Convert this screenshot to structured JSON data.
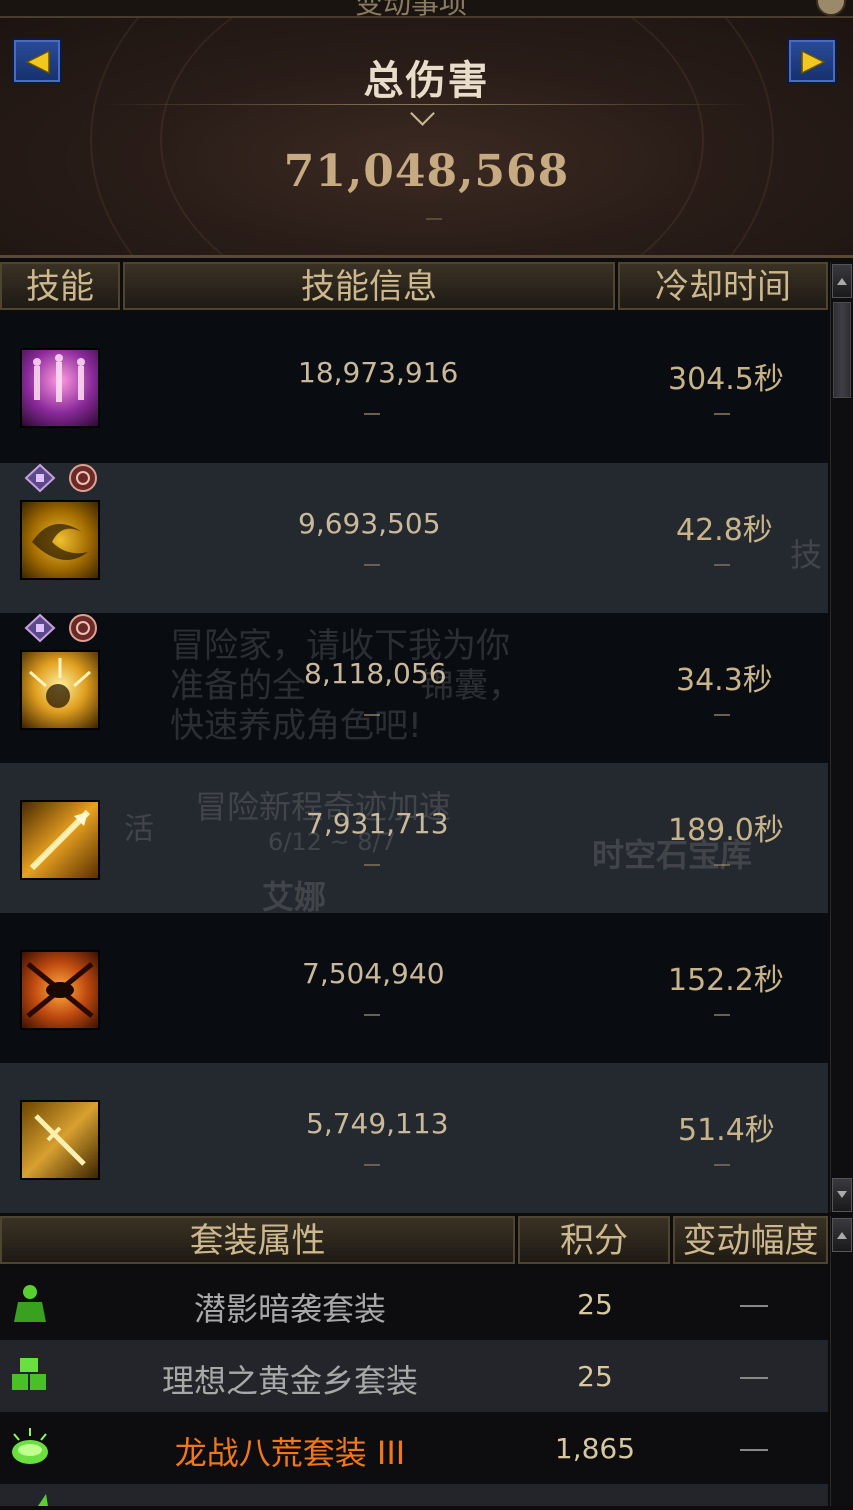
{
  "header": {
    "top_strip_text": "变动事项",
    "title": "总伤害",
    "total_damage": "71,048,568",
    "total_change": "–"
  },
  "skill_table": {
    "columns": [
      "技能",
      "技能信息",
      "冷却时间"
    ],
    "rows": [
      {
        "damage": "18,973,916",
        "damage_change": "–",
        "cooldown": "304.5秒",
        "cooldown_change": "–",
        "icon": "dancers-skill-icon",
        "badges": []
      },
      {
        "damage": "9,693,505",
        "damage_change": "–",
        "cooldown": "42.8秒",
        "cooldown_change": "–",
        "icon": "golden-swirl-skill-icon",
        "badges": [
          "diamond-badge-icon",
          "swirl-badge-icon"
        ]
      },
      {
        "damage": "8,118,056",
        "damage_change": "–",
        "cooldown": "34.3秒",
        "cooldown_change": "–",
        "icon": "golden-burst-skill-icon",
        "badges": [
          "diamond-badge-icon",
          "swirl-badge-icon"
        ]
      },
      {
        "damage": "7,931,713",
        "damage_change": "–",
        "cooldown": "189.0秒",
        "cooldown_change": "–",
        "icon": "golden-spear-skill-icon",
        "badges": []
      },
      {
        "damage": "7,504,940",
        "damage_change": "–",
        "cooldown": "152.2秒",
        "cooldown_change": "–",
        "icon": "orange-explosion-skill-icon",
        "badges": []
      },
      {
        "damage": "5,749,113",
        "damage_change": "–",
        "cooldown": "51.4秒",
        "cooldown_change": "–",
        "icon": "golden-sword-skill-icon",
        "badges": []
      }
    ]
  },
  "set_table": {
    "columns": [
      "套装属性",
      "积分",
      "变动幅度"
    ],
    "rows": [
      {
        "name": "潜影暗袭套装",
        "score": "25",
        "change": "–",
        "color": "#a8a8a8",
        "icon": "green-person-icon"
      },
      {
        "name": "理想之黄金乡套装",
        "score": "25",
        "change": "–",
        "color": "#a8a8a8",
        "icon": "green-blocks-icon"
      },
      {
        "name": "龙战八荒套装 III",
        "score": "1,865",
        "change": "–",
        "color": "#f07818",
        "icon": "green-glow-icon"
      }
    ]
  },
  "background_overlay_text": [
    "冒险家，请收下我为你",
    "准备的全",
    "锦囊，",
    "快速养成角色吧!",
    "冒险新程奇迹加速",
    "6/12 ~ 8/7",
    "时空石宝库",
    "艾娜",
    "技",
    "活"
  ]
}
